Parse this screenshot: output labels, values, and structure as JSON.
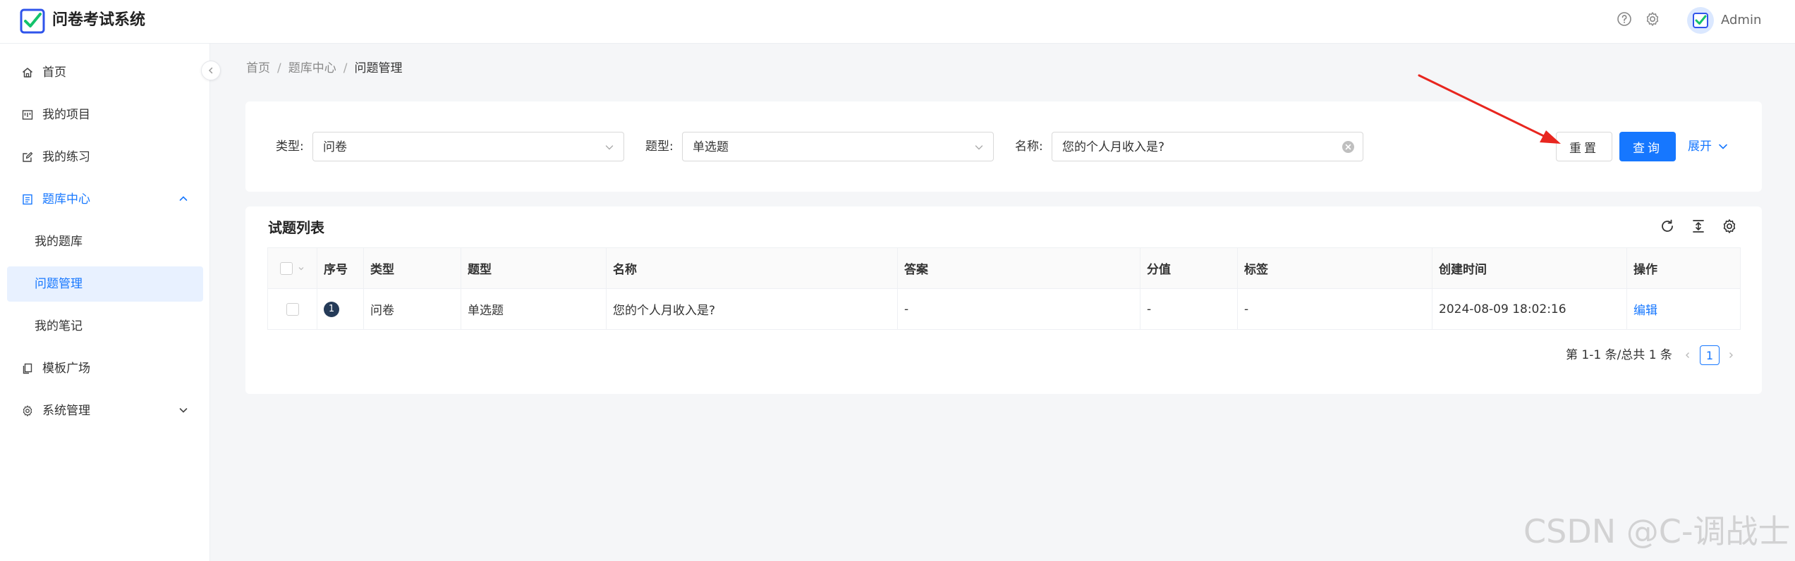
{
  "header": {
    "app_title": "问卷考试系统",
    "user_name": "Admin",
    "brand_color": "#1677ff"
  },
  "sidebar": {
    "items": [
      {
        "label": "首页",
        "icon": "home-icon"
      },
      {
        "label": "我的项目",
        "icon": "project-icon"
      },
      {
        "label": "我的练习",
        "icon": "edit-icon"
      },
      {
        "label": "题库中心",
        "icon": "list-icon",
        "expanded": true
      },
      {
        "label": "我的题库",
        "sub": true
      },
      {
        "label": "问题管理",
        "sub": true,
        "active": true
      },
      {
        "label": "我的笔记",
        "sub": true
      },
      {
        "label": "模板广场",
        "icon": "copy-icon"
      },
      {
        "label": "系统管理",
        "icon": "gear-icon",
        "expanded": false
      }
    ]
  },
  "breadcrumb": {
    "items": [
      "首页",
      "题库中心",
      "问题管理"
    ],
    "separator": "/"
  },
  "search": {
    "type_label": "类型:",
    "type_value": "问卷",
    "question_type_label": "题型:",
    "question_type_value": "单选题",
    "name_label": "名称:",
    "name_value": "您的个人月收入是?",
    "reset_label": "重置",
    "query_label": "查询",
    "expand_label": "展开"
  },
  "table": {
    "title": "试题列表",
    "columns": [
      "序号",
      "类型",
      "题型",
      "名称",
      "答案",
      "分值",
      "标签",
      "创建时间",
      "操作"
    ],
    "rows": [
      {
        "index": "1",
        "type": "问卷",
        "question_type": "单选题",
        "name": "您的个人月收入是?",
        "answer": "-",
        "score": "-",
        "tags": "-",
        "created": "2024-08-09 18:02:16",
        "action": "编辑"
      }
    ]
  },
  "pagination": {
    "summary": "第 1-1 条/总共 1 条",
    "current_page": "1"
  },
  "watermark": "CSDN @C-调战士"
}
